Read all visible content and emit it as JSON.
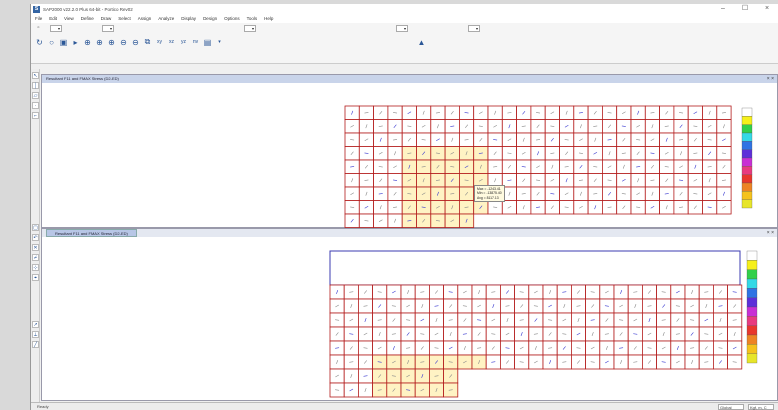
{
  "window": {
    "title": "SAP2000 v22.2.0 Plus 64-bit - Portico Rev02",
    "app_icon": "S",
    "min": "–",
    "max": "☐",
    "close": "×"
  },
  "menu": [
    "File",
    "Edit",
    "View",
    "Define",
    "Draw",
    "Select",
    "Assign",
    "Analyze",
    "Display",
    "Design",
    "Options",
    "Tools",
    "Help"
  ],
  "toolbar": {
    "icons": [
      "new-icon",
      "open-icon",
      "save-icon",
      "undo-icon",
      "redo-icon",
      "refresh-icon",
      "lock-icon",
      "run-icon"
    ]
  },
  "toolbar2": {
    "icons": [
      "rotate-icon",
      "zoom-in-icon",
      "zoom-window-icon",
      "zoom-out-icon",
      "zoom-all-icon",
      "pan-icon",
      "3d-view-icon",
      "xy-icon",
      "xz-icon",
      "yz-icon",
      "plan-icon",
      "options-icon"
    ],
    "glyphs": [
      "↻",
      "○",
      "▣",
      "▸",
      "⊕",
      "⊕",
      "⊕",
      "⊖",
      "⊖",
      "⧉",
      "xy",
      "xz",
      "yz",
      "nv",
      "▤",
      "▾"
    ]
  },
  "panes": {
    "top_title": "Resultant F11 and FMAX Stress (D2-ED)",
    "bottom_title": "Resultant F11 and FMAX Stress (D2-ED)",
    "close_label": "× ×"
  },
  "tooltip": {
    "line1": "Max = -1243.41",
    "line2": "Min = -13875.40",
    "line3": "Avg = 8117.13"
  },
  "status": {
    "left": "Ready",
    "combo1": "Global",
    "combo2": "Kgf, m, C"
  },
  "legend_colors": [
    "#ffffff",
    "#f6f01a",
    "#31d04b",
    "#33d9e6",
    "#2f73e4",
    "#5d2fd9",
    "#c82fd4",
    "#e83a7f",
    "#e8362c",
    "#ed8324",
    "#f5c21c",
    "#e7e52a"
  ],
  "mesh_color": "#b31b1b"
}
